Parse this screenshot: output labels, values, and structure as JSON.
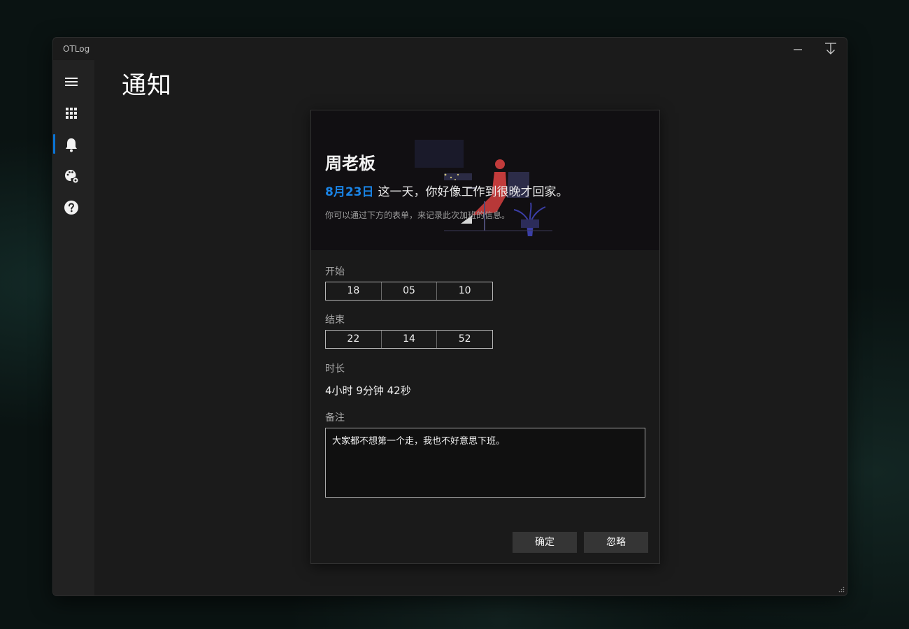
{
  "window": {
    "app_title": "OTLog",
    "page_title": "通知"
  },
  "sidebar": {
    "items": [
      {
        "icon": "hamburger-menu-icon"
      },
      {
        "icon": "grid-apps-icon"
      },
      {
        "icon": "bell-icon",
        "active": true
      },
      {
        "icon": "palette-settings-icon"
      },
      {
        "icon": "help-icon"
      }
    ]
  },
  "notification": {
    "boss_name": "周老板",
    "date": "8月23日",
    "message": "这一天，你好像工作到很晚才回家。",
    "hint": "你可以通过下方的表单，来记录此次加班的信息。",
    "start_label": "开始",
    "start": {
      "hour": "18",
      "minute": "05",
      "second": "10"
    },
    "end_label": "结束",
    "end": {
      "hour": "22",
      "minute": "14",
      "second": "52"
    },
    "duration_label": "时长",
    "duration_value": "4小时 9分钟 42秒",
    "note_label": "备注",
    "note_value": "大家都不想第一个走，我也不好意思下班。",
    "confirm_label": "确定",
    "ignore_label": "忽略"
  },
  "colors": {
    "accent": "#0a74d4",
    "date_highlight": "#1a84e6",
    "window_bg": "#1b1b1b",
    "sidebar_bg": "#222222",
    "banner_bg": "#110f12",
    "button_bg": "#353535"
  }
}
